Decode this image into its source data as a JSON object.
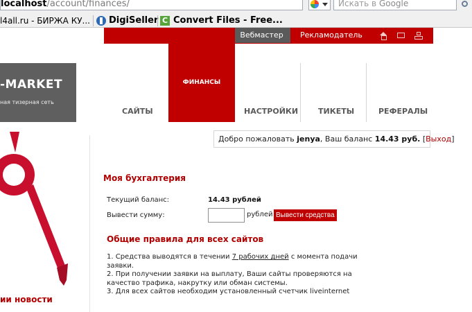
{
  "browser": {
    "address_host": "localhost",
    "address_path": "/account/finances/",
    "search_placeholder_prefix": "Искать в ",
    "search_placeholder_engine": "Google",
    "bookmarks": [
      {
        "label": "l4all.ru - БИРЖА КУ..."
      },
      {
        "label": "DigiSeller"
      },
      {
        "label": "Convert Files - Free..."
      }
    ]
  },
  "site": {
    "logo_title": "-MARKET",
    "logo_subtitle": "ная тизерная сеть",
    "topbar": {
      "webmaster": "Вебмастер",
      "advertiser": "Рекламодатель"
    },
    "nav": {
      "sites": "САЙТЫ",
      "finances": "ФИНАНСЫ",
      "settings": "НАСТРОЙКИ",
      "tickets": "ТИКЕТЫ",
      "referrals": "РЕФЕРАЛЫ"
    },
    "sidebar_news": "ии новости"
  },
  "welcome": {
    "greeting": "Добро пожаловать",
    "user": "jenya",
    "balance_text": ", Ваш баланс ",
    "balance": "14.43 руб.",
    "open_bracket": " [",
    "logout": "Выход",
    "close_bracket": "]"
  },
  "accounting": {
    "title": "Моя бухгалтерия",
    "current_balance_label": "Текущий баланс:",
    "current_balance_value": "14.43 рублей",
    "withdraw_label": "Вывести сумму:",
    "amount_value": "",
    "unit": "рублей",
    "withdraw_button": "Вывести средства"
  },
  "rules": {
    "title": "Общие правила для всех сайтов",
    "item1_pre": "1. Средства выводятся в течении ",
    "item1_link": "7 рабочих дней",
    "item1_post": " с момента подачи заявки.",
    "item2": "2. При получении заявки на выплату, Ваши сайты проверяются на качество трафика, накрутку или обман системы.",
    "item3": "3. Для всех сайтов необходим установленный счетчик liveinternet"
  },
  "colors": {
    "brand_red": "#c00000",
    "dark_gray": "#5a5a5a"
  }
}
